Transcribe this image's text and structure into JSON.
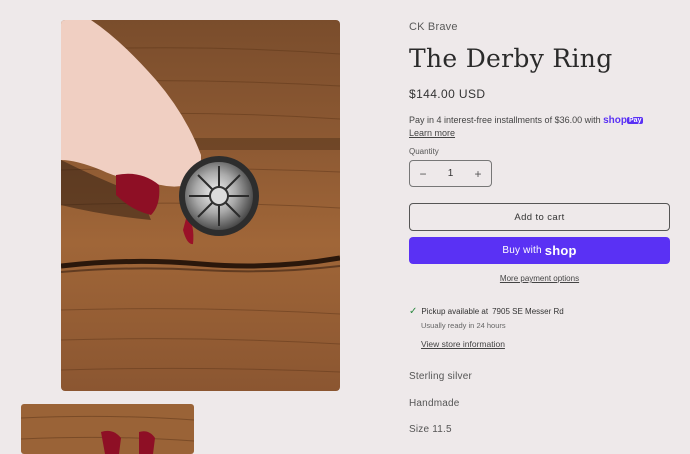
{
  "product": {
    "vendor": "CK Brave",
    "title": "The Derby Ring",
    "price": "$144.00 USD",
    "installments_text": "Pay in 4 interest-free installments of $36.00 with",
    "shoppay_logo": "shop",
    "shoppay_badge": "Pay",
    "learn_more": "Learn more",
    "quantity_label": "Quantity",
    "quantity_value": "1",
    "minus": "−",
    "plus": "+",
    "add_to_cart": "Add to cart",
    "buy_with": "Buy with",
    "buy_shop": "shop",
    "more_payment": "More payment options",
    "pickup_prefix": "Pickup available at",
    "pickup_location": "7905 SE Messer Rd",
    "ready_text": "Usually ready in 24 hours",
    "store_info": "View store information",
    "descriptions": [
      "Sterling silver",
      "Handmade",
      "Size 11.5"
    ]
  },
  "colors": {
    "background": "#eee9ea",
    "shop_purple": "#5a31f4",
    "check_green": "#2e8a43"
  }
}
